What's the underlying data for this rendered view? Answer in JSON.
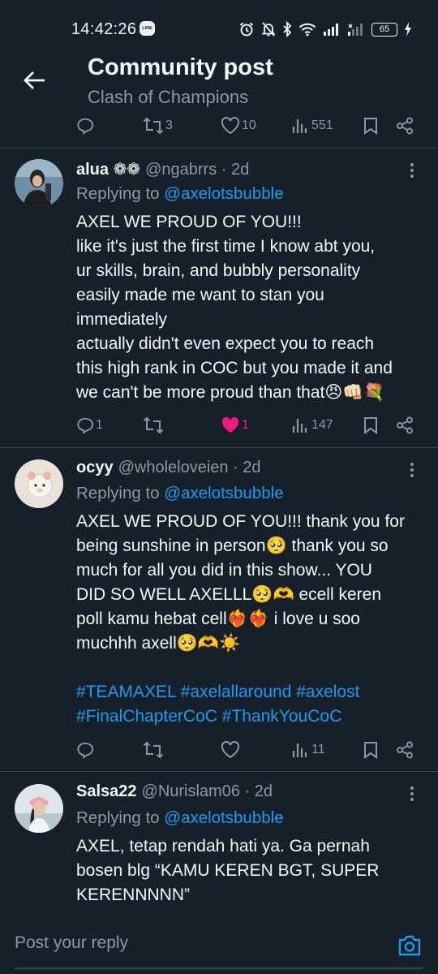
{
  "status_bar": {
    "time": "14:42:26",
    "line_badge": "LINE",
    "battery": "65"
  },
  "header": {
    "title": "Community post",
    "subtitle": "Clash of Champions"
  },
  "top_actions": {
    "replies": "",
    "retweets": "3",
    "likes": "10",
    "views": "551"
  },
  "tweets": [
    {
      "display_name": "alua ❁❁",
      "handle_meta": "@ngabrrs · 2d",
      "reply_label": "Replying to",
      "reply_mention": "@axelotsbubble",
      "lines": [
        "AXEL WE PROUD OF YOU!!!",
        "like it's just the first time I know abt you,",
        "ur skills, brain, and bubbly personality",
        "easily made me want to stan you",
        "immediately",
        "actually didn't even expect you to reach",
        "this high rank in COC but you made it and",
        "we can't be more proud than that😠👊🏻💐"
      ],
      "replies": "1",
      "retweets": "",
      "likes": "1",
      "views": "147"
    },
    {
      "display_name": "ocyy",
      "handle_meta": "@wholeloveien · 2d",
      "reply_label": "Replying to",
      "reply_mention": "@axelotsbubble",
      "lines": [
        "AXEL WE PROUD OF YOU!!! thank you for",
        "being sunshine in person🥺 thank you so",
        "much for all you did in this show... YOU",
        "DID SO WELL AXELLL🥺🫶 ecell keren",
        "poll kamu hebat cell❤️‍🔥❤️‍🔥 i love u soo",
        "muchhh axell🥺🫶☀️"
      ],
      "hashtag_lines": [
        "#TEAMAXEL #axelallaround #axelost",
        "#FinalChapterCoC #ThankYouCoC"
      ],
      "replies": "",
      "retweets": "",
      "likes": "",
      "views": "11"
    },
    {
      "display_name": "Salsa22",
      "handle_meta": "@Nurislam06 · 2d",
      "reply_label": "Replying to",
      "reply_mention": "@axelotsbubble",
      "lines": [
        "AXEL, tetap rendah hati ya. Ga pernah",
        "bosen blg “KAMU KEREN BGT, SUPER",
        "KERENNNNN”"
      ]
    }
  ],
  "reply_bar": {
    "placeholder": "Post your reply"
  },
  "colors": {
    "background": "#15202b",
    "text": "#f7f9f9",
    "muted": "#8b98a5",
    "accent": "#1d9bf0",
    "like": "#f91880",
    "divider": "#38444d"
  },
  "icons": [
    "back-arrow-icon",
    "reply-icon",
    "retweet-icon",
    "heart-icon",
    "views-icon",
    "bookmark-icon",
    "share-icon",
    "more-icon",
    "camera-icon"
  ]
}
